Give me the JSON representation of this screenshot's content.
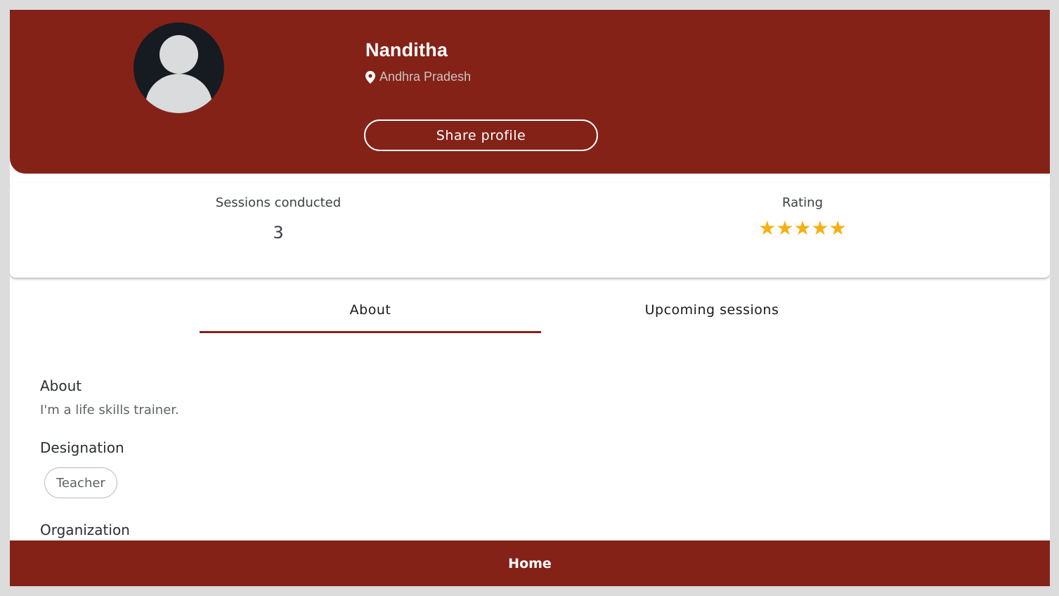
{
  "profile": {
    "name": "Nanditha",
    "location": "Andhra Pradesh",
    "share_label": "Share profile",
    "avatar_icon": "user-avatar-icon",
    "location_icon": "map-pin-icon"
  },
  "stats": {
    "sessions_label": "Sessions conducted",
    "sessions_value": "3",
    "rating_label": "Rating",
    "rating_stars": "★★★★★",
    "rating_value": 5,
    "rating_max": 5
  },
  "tabs": [
    {
      "label": "About",
      "active": true
    },
    {
      "label": "Upcoming sessions",
      "active": false
    }
  ],
  "about": {
    "about_title": "About",
    "about_text": "I'm a life skills trainer.",
    "designation_title": "Designation",
    "designation_chip": "Teacher",
    "organization_title": "Organization"
  },
  "bottom_nav": {
    "home_label": "Home"
  },
  "colors": {
    "brand": "#852218",
    "star": "#f6b012"
  }
}
